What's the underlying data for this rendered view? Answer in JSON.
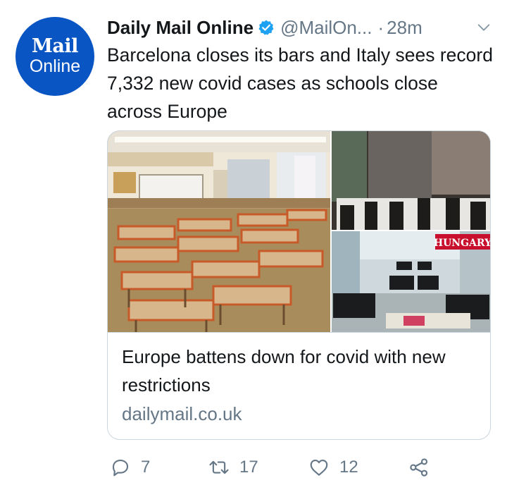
{
  "tweet": {
    "avatar_line1": "Mail",
    "avatar_line2": "Online",
    "author_name": "Daily Mail Online",
    "handle": "@MailOn...",
    "dot": "·",
    "time": "28m",
    "text": "Barcelona closes its bars and Italy sees record 7,332 new covid cases as schools close across Europe"
  },
  "card": {
    "image_label": "HUNGARY",
    "title": "Europe battens down for covid with new restrictions",
    "domain": "dailymail.co.uk"
  },
  "actions": {
    "reply_count": "7",
    "retweet_count": "17",
    "like_count": "12"
  },
  "colors": {
    "brand_blue": "#0a55c4",
    "verified_blue": "#1da1f2",
    "muted_text": "#657786",
    "hungary_red": "#c8102e"
  }
}
